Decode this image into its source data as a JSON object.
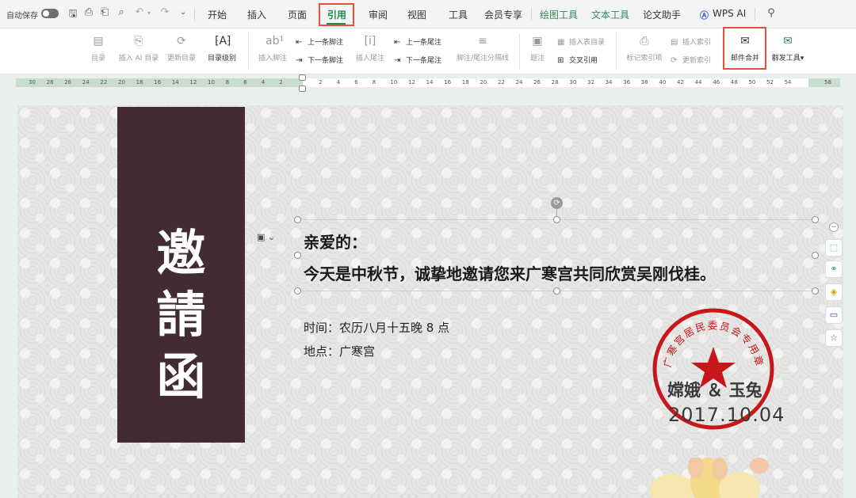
{
  "menubar": {
    "autosave_label": "自动保存",
    "tabs": [
      "开始",
      "插入",
      "页面",
      "引用",
      "审阅",
      "视图",
      "工具",
      "会员专享",
      "绘图工具",
      "文本工具",
      "论文助手",
      "WPS AI"
    ]
  },
  "ribbon": {
    "toc": "目录",
    "ai_toc": "插入 AI 目录",
    "update_toc": "更新目录",
    "toc_level": "目录级别",
    "insert_footnote": "插入脚注",
    "prev_footnote": "上一条脚注",
    "next_footnote": "下一条脚注",
    "insert_endnote": "插入尾注",
    "prev_endnote": "上一条尾注",
    "next_endnote": "下一条尾注",
    "note_separator": "脚注/尾注分隔线",
    "caption": "题注",
    "insert_table_of_figures": "插入表目录",
    "cross_reference": "交叉引用",
    "mark_citation": "标记索引项",
    "insert_index": "插入索引",
    "update_index": "更新索引",
    "mail_merge": "邮件合并",
    "mass_send": "群发工具"
  },
  "ruler": {
    "left_numbers": [
      "30",
      "28",
      "26",
      "24",
      "22",
      "20",
      "18",
      "16",
      "14",
      "12",
      "10",
      "8",
      "6",
      "4",
      "2"
    ],
    "right_numbers": [
      "2",
      "4",
      "6",
      "8",
      "10",
      "12",
      "14",
      "16",
      "18",
      "20",
      "22",
      "24",
      "26",
      "28",
      "30",
      "32",
      "34",
      "36",
      "38",
      "40",
      "42",
      "44",
      "46",
      "48",
      "50",
      "52",
      "54",
      "58"
    ]
  },
  "document": {
    "banner_chars": [
      "邀",
      "請",
      "函"
    ],
    "greeting": "亲爱的：",
    "body": "今天是中秋节，诚挚地邀请您来广寒宫共同欣赏吴刚伐桂。",
    "time": "时间：农历八月十五晚 8 点",
    "place": "地点：广寒宫",
    "signers": "嫦娥 ＆ 玉兔",
    "date": "2017.10.04",
    "stamp_text": "广寒宫居民委员会专用章",
    "stamp_color": "#c8161d",
    "banner_color": "#432b36"
  },
  "colors": {
    "accent": "#1f8a4c",
    "highlight_box": "#e8503a"
  }
}
